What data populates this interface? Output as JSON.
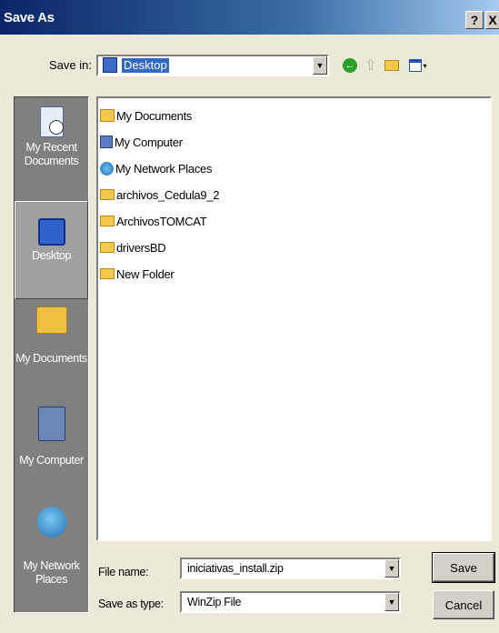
{
  "window": {
    "title": "Save As",
    "help_glyph": "?",
    "close_glyph": "X"
  },
  "save_in": {
    "label": "Save in:",
    "value": "Desktop",
    "dropdown_glyph": "▼"
  },
  "toolbar": {
    "back_glyph": "←",
    "up_glyph": "⇧",
    "views_dropdown_glyph": "▾"
  },
  "places": [
    {
      "label": "My Recent Documents",
      "icon": "recent-documents-icon"
    },
    {
      "label": "Desktop",
      "icon": "desktop-icon"
    },
    {
      "label": "My Documents",
      "icon": "my-documents-icon"
    },
    {
      "label": "My Computer",
      "icon": "my-computer-icon"
    },
    {
      "label": "My Network Places",
      "icon": "network-places-icon"
    }
  ],
  "files": [
    {
      "name": "My Documents",
      "icon": "my-documents-icon"
    },
    {
      "name": "My Computer",
      "icon": "my-computer-icon"
    },
    {
      "name": "My Network Places",
      "icon": "network-places-icon"
    },
    {
      "name": "archivos_Cedula9_2",
      "icon": "folder-icon"
    },
    {
      "name": "ArchivosTOMCAT",
      "icon": "folder-icon"
    },
    {
      "name": "driversBD",
      "icon": "folder-icon"
    },
    {
      "name": "New Folder",
      "icon": "folder-icon"
    }
  ],
  "file_name": {
    "label": "File name:",
    "value": "iniciativas_install.zip"
  },
  "save_as_type": {
    "label": "Save as type:",
    "value": "WinZip File"
  },
  "buttons": {
    "save": "Save",
    "cancel": "Cancel"
  }
}
